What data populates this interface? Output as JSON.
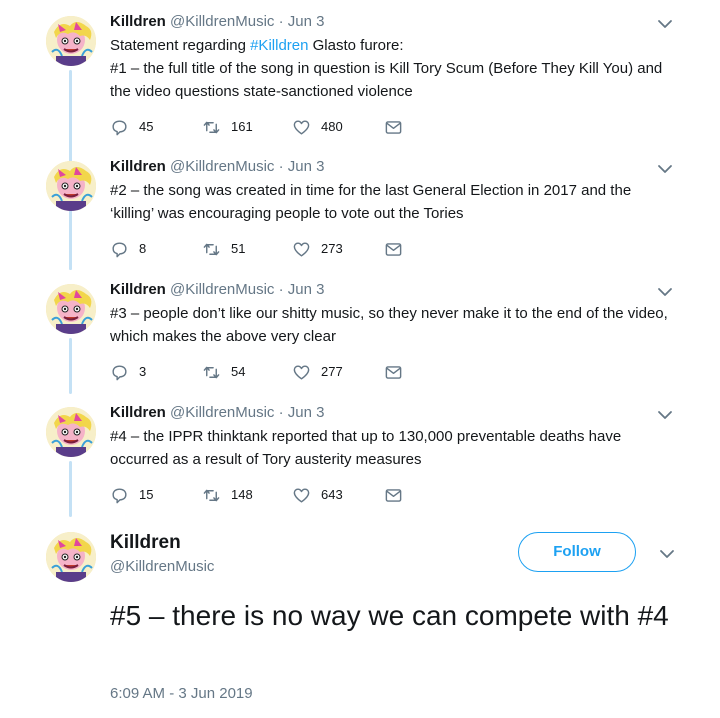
{
  "tweets": [
    {
      "name": "Killdren",
      "handle": "@KilldrenMusic",
      "dot": "·",
      "date": "Jun 3",
      "text_before": "Statement regarding ",
      "hashtag": "#Killdren",
      "text_after": " Glasto furore:",
      "line2": "#1 – the full title of the song in question is Kill Tory Scum (Before They Kill You) and the video questions state-sanctioned violence",
      "replies": "45",
      "retweets": "161",
      "likes": "480"
    },
    {
      "name": "Killdren",
      "handle": "@KilldrenMusic",
      "dot": "·",
      "date": "Jun 3",
      "text": "#2 – the song was created in time for the last General Election in 2017 and the ‘killing’ was encouraging people to vote out the Tories",
      "replies": "8",
      "retweets": "51",
      "likes": "273"
    },
    {
      "name": "Killdren",
      "handle": "@KilldrenMusic",
      "dot": "·",
      "date": "Jun 3",
      "text": "#3 – people don’t like our shitty music, so they never make it to the end of the video, which makes the above very clear",
      "replies": "3",
      "retweets": "54",
      "likes": "277"
    },
    {
      "name": "Killdren",
      "handle": "@KilldrenMusic",
      "dot": "·",
      "date": "Jun 3",
      "text": "#4 – the IPPR thinktank reported that up to 130,000 preventable deaths have occurred as a result of Tory austerity measures",
      "replies": "15",
      "retweets": "148",
      "likes": "643"
    }
  ],
  "main": {
    "name": "Killdren",
    "handle": "@KilldrenMusic",
    "follow_label": "Follow",
    "text": "#5 – there is no way we can compete with #4",
    "timestamp": "6:09 AM - 3 Jun 2019"
  },
  "colors": {
    "accent": "#1da1f2",
    "muted": "#657786",
    "thread_line": "#c4e1f5",
    "text": "#14171a"
  },
  "icons": [
    "reply-icon",
    "retweet-icon",
    "like-icon",
    "direct-message-icon",
    "chevron-down-icon"
  ]
}
